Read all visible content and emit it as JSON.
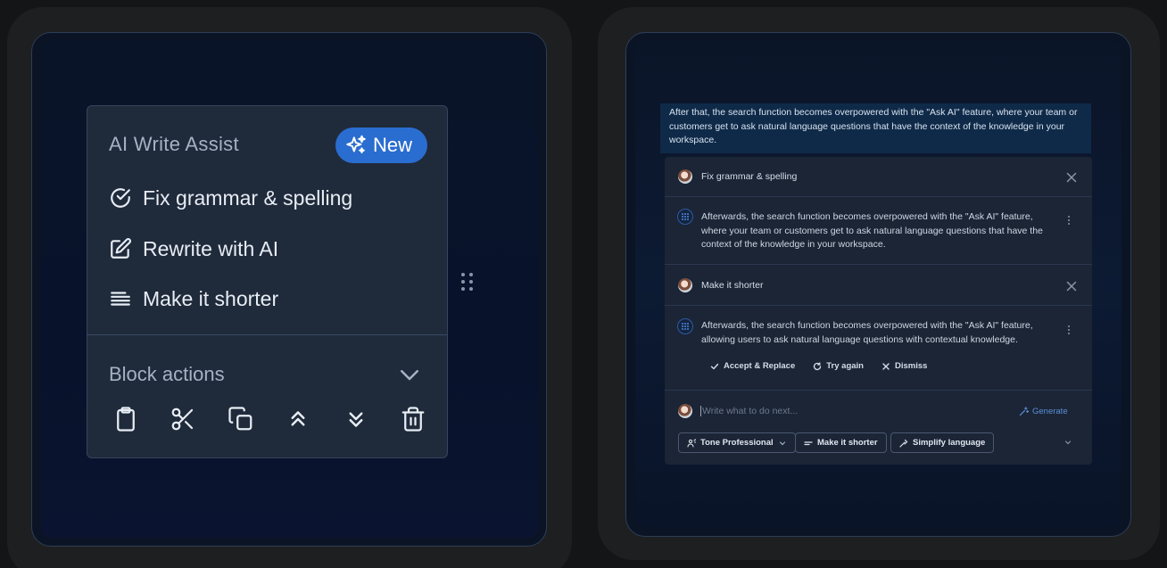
{
  "left_panel": {
    "menu_title": "AI Write Assist",
    "badge": "New",
    "items": [
      {
        "label": "Fix grammar & spelling",
        "icon": "check-circle-icon"
      },
      {
        "label": "Rewrite with AI",
        "icon": "edit-icon"
      },
      {
        "label": "Make it shorter",
        "icon": "lines-icon"
      }
    ],
    "block_actions_title": "Block actions",
    "tools": [
      "clipboard-icon",
      "scissors-icon",
      "copy-icon",
      "move-up-icon",
      "move-down-icon",
      "trash-icon"
    ]
  },
  "right_panel": {
    "selected_text": "After that, the search function becomes overpowered with the \"Ask AI\" feature, where your team or customers get to ask natural language questions that have the context of the knowledge in your workspace.",
    "request1": "Fix grammar & spelling",
    "response1": "Afterwards, the search function becomes overpowered with the \"Ask AI\" feature, where your team or customers get to ask natural language questions that have the context of the knowledge in your workspace.",
    "request2": "Make it shorter",
    "response2": "Afterwards, the search function becomes overpowered with the \"Ask AI\" feature, allowing users to ask natural language questions with contextual knowledge.",
    "actions": {
      "accept": "Accept & Replace",
      "retry": "Try again",
      "dismiss": "Dismiss"
    },
    "prompt_placeholder": "Write what to do next...",
    "generate": "Generate",
    "chips": {
      "tone": "Tone Professional",
      "shorter": "Make it shorter",
      "simplify": "Simplify language"
    }
  },
  "colors": {
    "accent": "#2a6dd0",
    "link": "#5b8fd6",
    "menu_bg": "#1f2a3b",
    "card_bg": "#1b2536"
  }
}
